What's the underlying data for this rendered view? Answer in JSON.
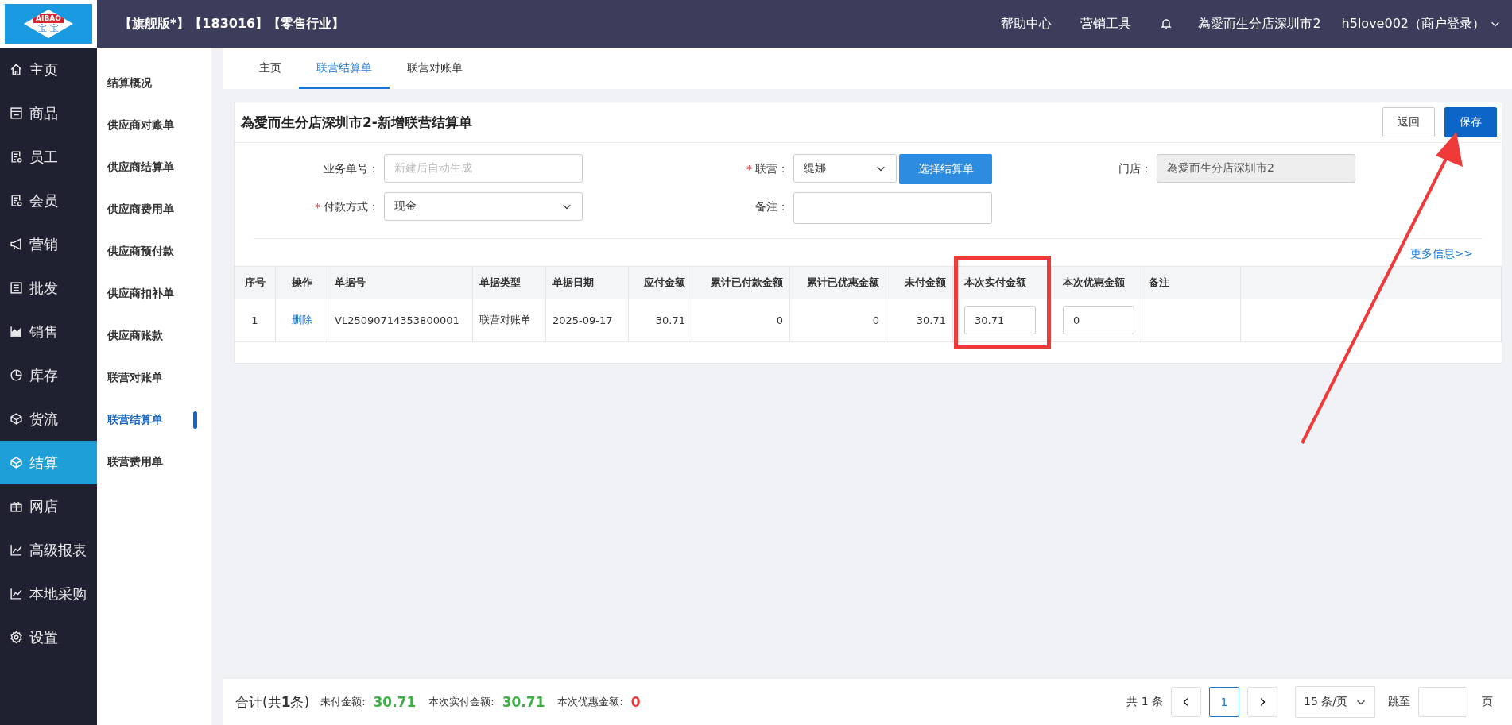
{
  "logo": {
    "brand": "AIBAO",
    "sub": "宝 宝"
  },
  "topbar": {
    "edition": "【旗舰版*】【183016】【零售行业】",
    "links": [
      "帮助中心",
      "营销工具"
    ],
    "store": "為愛而生分店深圳市2",
    "user": "h5love002（商户登录）"
  },
  "sidebar": {
    "items": [
      {
        "label": "主页",
        "kind": "home",
        "selected": false
      },
      {
        "label": "商品",
        "kind": "shop",
        "selected": false
      },
      {
        "label": "员工",
        "kind": "doc",
        "selected": false
      },
      {
        "label": "会员",
        "kind": "doc",
        "selected": false
      },
      {
        "label": "营销",
        "kind": "horn",
        "selected": false
      },
      {
        "label": "批发",
        "kind": "list",
        "selected": false
      },
      {
        "label": "销售",
        "kind": "area",
        "selected": false
      },
      {
        "label": "库存",
        "kind": "pie",
        "selected": false
      },
      {
        "label": "货流",
        "kind": "cube",
        "selected": false
      },
      {
        "label": "结算",
        "kind": "cube",
        "selected": true
      },
      {
        "label": "网店",
        "kind": "gift",
        "selected": false
      },
      {
        "label": "高级报表",
        "kind": "line",
        "selected": false
      },
      {
        "label": "本地采购",
        "kind": "line",
        "selected": false
      },
      {
        "label": "设置",
        "kind": "gear",
        "selected": false
      }
    ]
  },
  "submenu": {
    "items": [
      {
        "label": "结算概况",
        "selected": false
      },
      {
        "label": "供应商对账单",
        "selected": false
      },
      {
        "label": "供应商结算单",
        "selected": false
      },
      {
        "label": "供应商费用单",
        "selected": false
      },
      {
        "label": "供应商预付款",
        "selected": false
      },
      {
        "label": "供应商扣补单",
        "selected": false
      },
      {
        "label": "供应商账款",
        "selected": false
      },
      {
        "label": "联营对账单",
        "selected": false
      },
      {
        "label": "联营结算单",
        "selected": true
      },
      {
        "label": "联营费用单",
        "selected": false
      }
    ]
  },
  "tabs": [
    {
      "label": "主页",
      "selected": false
    },
    {
      "label": "联营结算单",
      "selected": true
    },
    {
      "label": "联营对账单",
      "selected": false
    }
  ],
  "form": {
    "title": "為愛而生分店深圳市2-新增联营结算单",
    "buttons": [
      {
        "label": "返回",
        "kind": "default"
      },
      {
        "label": "保存",
        "kind": "primary"
      }
    ],
    "fields": [
      {
        "label": "业务单号：",
        "kind": "text",
        "placeholder": "新建后自动生成"
      },
      {
        "mark": "*",
        "label": "联营：",
        "kind": "select",
        "value": "缇娜",
        "action": "选择结算单"
      },
      {
        "label": "门店：",
        "kind": "readonly",
        "value": "為愛而生分店深圳市2"
      },
      {
        "mark": "*",
        "label": "付款方式：",
        "kind": "select",
        "value": "现金"
      },
      {
        "label": "备注：",
        "kind": "textarea"
      }
    ],
    "more_link": "更多信息>>"
  },
  "table": {
    "columns": [
      {
        "label": "序号"
      },
      {
        "label": "操作"
      },
      {
        "label": "单据号"
      },
      {
        "label": "单据类型"
      },
      {
        "label": "单据日期"
      },
      {
        "label": "应付金额"
      },
      {
        "label": "累计已付款金额"
      },
      {
        "label": "累计已优惠金额"
      },
      {
        "label": "未付金额"
      },
      {
        "label": "本次实付金额"
      },
      {
        "label": "本次优惠金额"
      },
      {
        "label": "备注"
      }
    ],
    "rows": [
      {
        "cells": [
          {
            "kind": "text",
            "value": "1"
          },
          {
            "kind": "link",
            "value": "删除"
          },
          {
            "kind": "text",
            "value": "VL25090714353800001"
          },
          {
            "kind": "text",
            "value": "联营对账单"
          },
          {
            "kind": "text",
            "value": "2025-09-17"
          },
          {
            "kind": "text",
            "value": "30.71"
          },
          {
            "kind": "text",
            "value": "0"
          },
          {
            "kind": "text",
            "value": "0"
          },
          {
            "kind": "text",
            "value": "30.71"
          },
          {
            "kind": "input",
            "value": "30.71"
          },
          {
            "kind": "input",
            "value": "0"
          },
          {
            "kind": "empty"
          }
        ]
      }
    ]
  },
  "footer": {
    "total": "合计(共**1**条)",
    "sums": [
      {
        "label": "未付金额:",
        "value": "30.71",
        "color": "#3cb043"
      },
      {
        "label": "本次实付金额:",
        "value": "30.71",
        "color": "#3cb043"
      },
      {
        "label": "本次优惠金额:",
        "value": "0",
        "color": "#ee3333"
      }
    ],
    "pager": {
      "count": "共 1 条",
      "pages": [
        {
          "label": "1",
          "selected": true
        }
      ],
      "size": "15 条/页",
      "jump": "跳至",
      "unit": "页"
    }
  },
  "annotations": {
    "frame": true,
    "arrow": true
  }
}
